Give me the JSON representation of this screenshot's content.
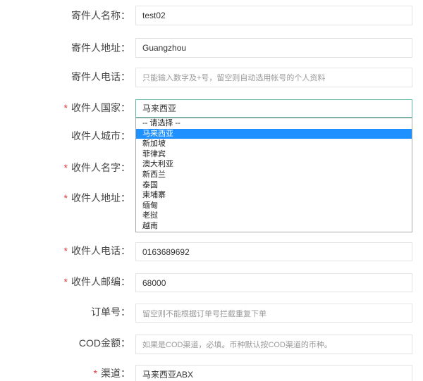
{
  "required_mark": "*",
  "colors": {
    "label_text": "#444444",
    "required": "#e4393c",
    "input_border": "#e3e3e3",
    "focus_border": "#5fb7a2",
    "option_highlight": "#1e90ff"
  },
  "form": {
    "sender_name": {
      "label": "寄件人名称：",
      "value": "test02"
    },
    "sender_address": {
      "label": "寄件人地址：",
      "value": "Guangzhou"
    },
    "sender_phone": {
      "label": "寄件人电话：",
      "placeholder": "只能输入数字及+号，留空则自动选用帐号的个人资料"
    },
    "recipient_country": {
      "label": "收件人国家：",
      "required": true,
      "selected": "马来西亚",
      "dropdown_open": true,
      "highlighted_index": 1,
      "options": [
        "-- 请选择 --",
        "马来西亚",
        "新加坡",
        "菲律宾",
        "澳大利亚",
        "新西兰",
        "泰国",
        "柬埔寨",
        "缅甸",
        "老挝",
        "越南"
      ]
    },
    "recipient_city": {
      "label": "收件人城市："
    },
    "recipient_name": {
      "label": "收件人名字：",
      "required": true
    },
    "recipient_address": {
      "label": "收件人地址：",
      "required": true
    },
    "recipient_phone": {
      "label": "收件人电话：",
      "required": true,
      "value": "0163689692"
    },
    "recipient_zip": {
      "label": "收件人邮编：",
      "required": true,
      "value": "68000"
    },
    "order_number": {
      "label": "订单号：",
      "placeholder": "留空则不能根据订单号拦截重复下单"
    },
    "cod_amount": {
      "label": "COD金额：",
      "placeholder": "如果是COD渠道，必填。币种默认按COD渠道的币种。"
    },
    "channel": {
      "label": "渠道：",
      "required": true,
      "value": "马来西亚ABX"
    }
  }
}
